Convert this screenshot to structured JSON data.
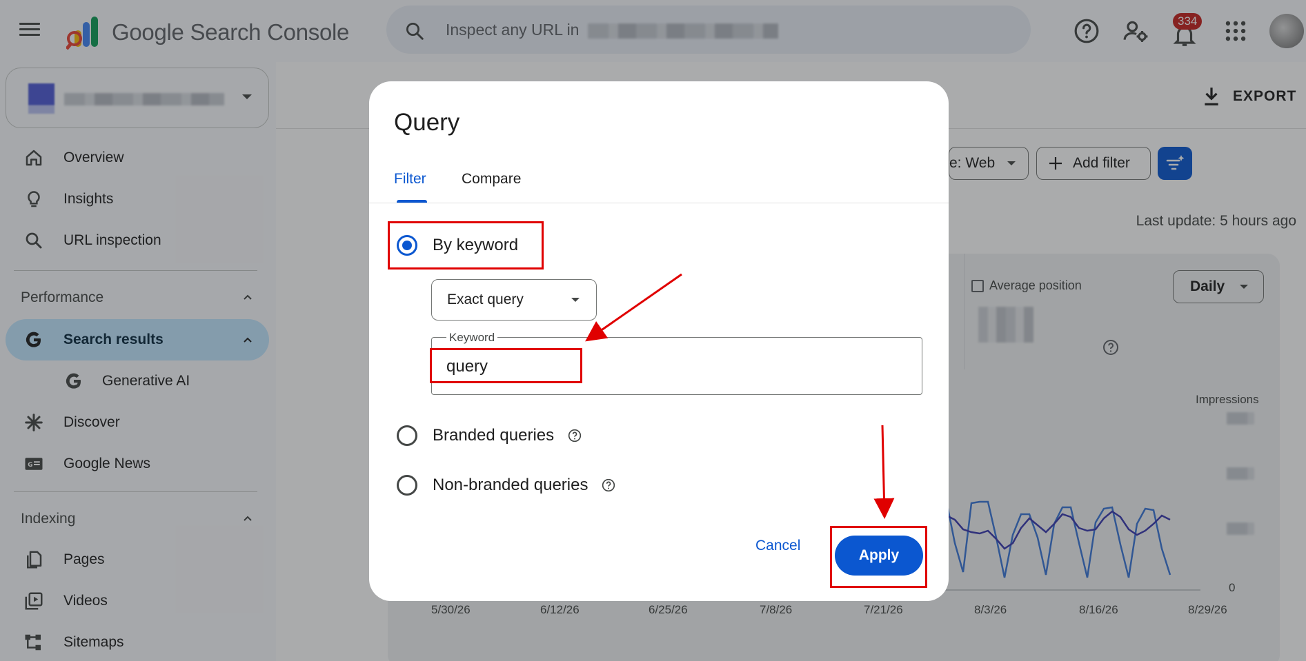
{
  "header": {
    "app_title": "Google Search Console",
    "search_placeholder": "Inspect any URL in",
    "notification_count": "334",
    "icons": [
      "menu-icon",
      "search-icon",
      "help-icon",
      "manage-users-icon",
      "notifications-icon",
      "apps-grid-icon",
      "avatar"
    ]
  },
  "sidebar": {
    "items": [
      {
        "label": "Overview",
        "icon": "home-icon"
      },
      {
        "label": "Insights",
        "icon": "lightbulb-icon"
      },
      {
        "label": "URL inspection",
        "icon": "search-icon"
      }
    ],
    "performance": {
      "title": "Performance",
      "items": [
        {
          "label": "Search results",
          "icon": "google-g-icon"
        },
        {
          "label": "Generative AI",
          "icon": "google-g-icon"
        },
        {
          "label": "Discover",
          "icon": "asterisk-icon"
        },
        {
          "label": "Google News",
          "icon": "news-icon"
        }
      ]
    },
    "indexing": {
      "title": "Indexing",
      "items": [
        {
          "label": "Pages",
          "icon": "pages-icon"
        },
        {
          "label": "Videos",
          "icon": "video-icon"
        },
        {
          "label": "Sitemaps",
          "icon": "sitemap-icon"
        }
      ]
    }
  },
  "main": {
    "export_label": "EXPORT",
    "search_type_chip": "e: Web",
    "add_filter_label": "Add filter",
    "last_update": "Last update: 5 hours ago",
    "metric_label": "Average position",
    "granularity": "Daily",
    "right_axis_label": "Impressions",
    "right_axis_zero": "0",
    "x_labels": [
      "5/30/26",
      "6/12/26",
      "6/25/26",
      "7/8/26",
      "7/21/26",
      "8/3/26",
      "8/16/26",
      "8/29/26"
    ]
  },
  "dialog": {
    "title": "Query",
    "tabs": [
      "Filter",
      "Compare"
    ],
    "options": {
      "by_keyword": "By keyword",
      "branded": "Branded queries",
      "non_branded": "Non-branded queries"
    },
    "selected_option": "By keyword",
    "match_type": "Exact query",
    "keyword_label": "Keyword",
    "keyword_value": "query",
    "cancel_label": "Cancel",
    "apply_label": "Apply"
  },
  "colors": {
    "accent": "#0b57d0",
    "highlight": "#e00000",
    "active_nav": "#c2e7ff",
    "line_clicks": "#3b3bb0",
    "line_impressions": "#3c78d8"
  }
}
